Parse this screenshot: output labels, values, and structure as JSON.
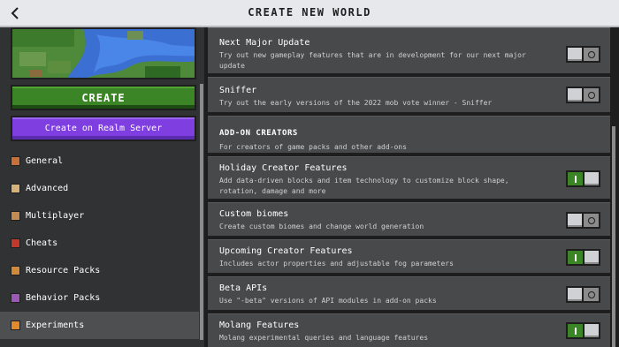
{
  "header": {
    "title": "CREATE NEW WORLD"
  },
  "sidebar": {
    "create_label": "CREATE",
    "realm_label": "Create on Realm Server",
    "items": [
      {
        "label": "General",
        "icon": "general-icon",
        "color": "#c7703a"
      },
      {
        "label": "Advanced",
        "icon": "advanced-icon",
        "color": "#d4b27a"
      },
      {
        "label": "Multiplayer",
        "icon": "multiplayer-icon",
        "color": "#c08a52"
      },
      {
        "label": "Cheats",
        "icon": "cheats-icon",
        "color": "#c0392b"
      },
      {
        "label": "Resource Packs",
        "icon": "resource-packs-icon",
        "color": "#d08a3a"
      },
      {
        "label": "Behavior Packs",
        "icon": "behavior-packs-icon",
        "color": "#9b59b6"
      },
      {
        "label": "Experiments",
        "icon": "experiments-icon",
        "color": "#e08a2e"
      }
    ],
    "active": "Experiments"
  },
  "main": {
    "rows": [
      {
        "title": "Next Major Update",
        "desc": "Try out new gameplay features that are in development for our next major update",
        "on": false
      },
      {
        "title": "Sniffer",
        "desc": "Try out the early versions of the 2022 mob vote winner - Sniffer",
        "on": false
      }
    ],
    "section": {
      "title": "ADD-ON CREATORS",
      "desc": "For creators of game packs and other add-ons"
    },
    "addon_rows": [
      {
        "title": "Holiday Creator Features",
        "desc": "Add data-driven blocks and item technology to customize block shape, rotation, damage and more",
        "on": true
      },
      {
        "title": "Custom biomes",
        "desc": "Create custom biomes and change world generation",
        "on": false
      },
      {
        "title": "Upcoming Creator Features",
        "desc": "Includes actor properties and adjustable fog parameters",
        "on": true
      },
      {
        "title": "Beta APIs",
        "desc": "Use \"-beta\" versions of API modules in add-on packs",
        "on": false
      },
      {
        "title": "Molang Features",
        "desc": "Molang experimental queries and language features",
        "on": true
      }
    ]
  },
  "colors": {
    "green": "#3c8527",
    "purple": "#7f3fe0",
    "panel": "#48494a",
    "header": "#e6e8eb"
  }
}
